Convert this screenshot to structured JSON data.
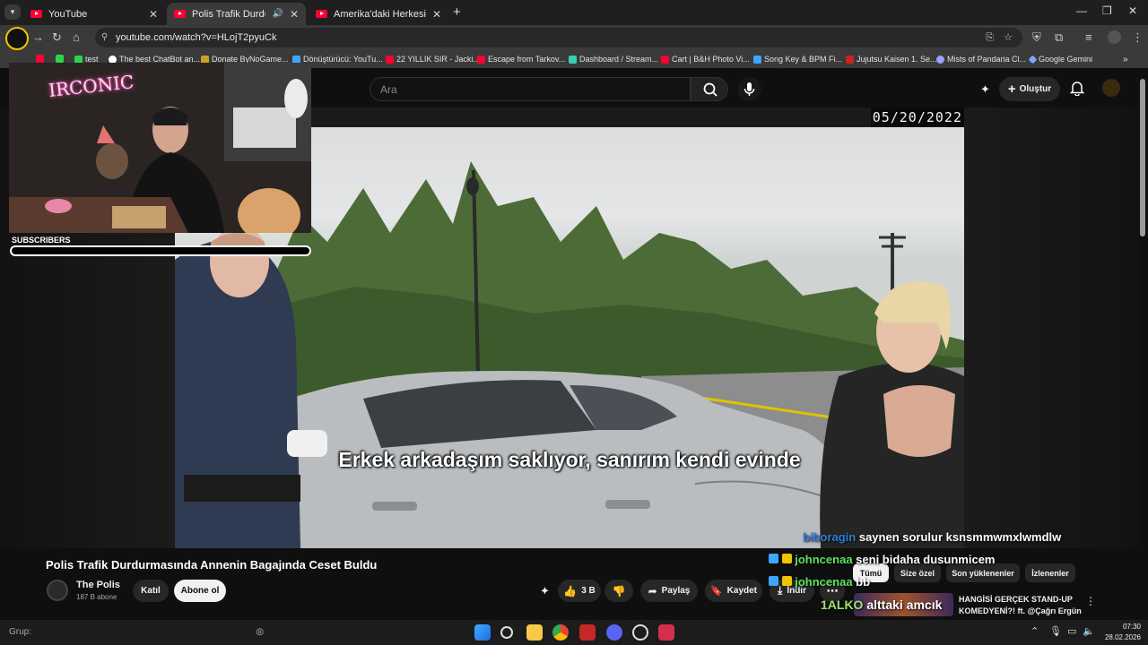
{
  "browser": {
    "tabs": [
      {
        "title": "YouTube",
        "active": false
      },
      {
        "title": "Polis Trafik Durdurmasında",
        "active": true
      },
      {
        "title": "Amerika'daki Herkesi Dedektif",
        "active": false
      }
    ],
    "url": "youtube.com/watch?v=HLojT2pyuCk",
    "bookmarks": [
      {
        "label": "test",
        "color": "#2bd44a"
      },
      {
        "label": "The best ChatBot an...",
        "color": "#ffffff"
      },
      {
        "label": "Donate ByNoGame...",
        "color": "#c9a227"
      },
      {
        "label": "Dönüştürücü: YouTu...",
        "color": "#3ea6ff"
      },
      {
        "label": "22 YILLIK SIR - Jacki...",
        "color": "#ff0033"
      },
      {
        "label": "Escape from Tarkov...",
        "color": "#ff0033"
      },
      {
        "label": "Dashboard / Stream...",
        "color": "#35d0b2"
      },
      {
        "label": "Cart | B&H Photo Vi...",
        "color": "#ff0033"
      },
      {
        "label": "Song Key & BPM Fi...",
        "color": "#3ea6ff"
      },
      {
        "label": "Jujutsu Kaisen 1. Se...",
        "color": "#cc2222"
      },
      {
        "label": "Mists of Pandaria Cl...",
        "color": "#a0a0ff"
      },
      {
        "label": "Google Gemini",
        "color": "#7aa8ff"
      }
    ]
  },
  "youtube": {
    "search_placeholder": "Ara",
    "create_label": "Oluştur",
    "video_title": "Polis Trafik Durdurmasında Annenin Bagajında Ceset Buldu",
    "channel_name": "The Polis",
    "subscriber_count": "187 B abone",
    "join_label": "Katıl",
    "subscribe_label": "Abone ol",
    "like_count": "3 B",
    "share_label": "Paylaş",
    "save_label": "Kaydet",
    "download_label": "İndir",
    "chips": [
      "Tümü",
      "Size özel",
      "Son yüklenenler",
      "İzlenenler"
    ],
    "recommended_title_1": "HANGİSİ GERÇEK STAND-UP",
    "recommended_title_2": "KOMEDYENİ?! ft. @Çağrı Ergün",
    "thumbnail_text": "alttaki amcık"
  },
  "video": {
    "subtitle": "Erkek arkadaşım saklıyor, sanırım kendi evinde",
    "datestamp": "05/20/2022"
  },
  "overlay": {
    "webcam_sign": "IRCONIC",
    "subscribers_label": "SUBSCRIBERS",
    "chat": [
      {
        "user": "biboragin",
        "text": "saynen sorulur ksnsmmwmxlwmdlw",
        "user_color": "#2e7cd6"
      },
      {
        "user": "johncenaa",
        "text": "seni bidaha dusunmicem",
        "user_color": "#5ee35e"
      },
      {
        "user": "johncenaa",
        "text": "bb",
        "user_color": "#5ee35e"
      }
    ],
    "bottom_name": "1ALKO"
  },
  "taskbar": {
    "search_label": "Grup:",
    "time": "07:30",
    "date": "28.02.2026"
  }
}
